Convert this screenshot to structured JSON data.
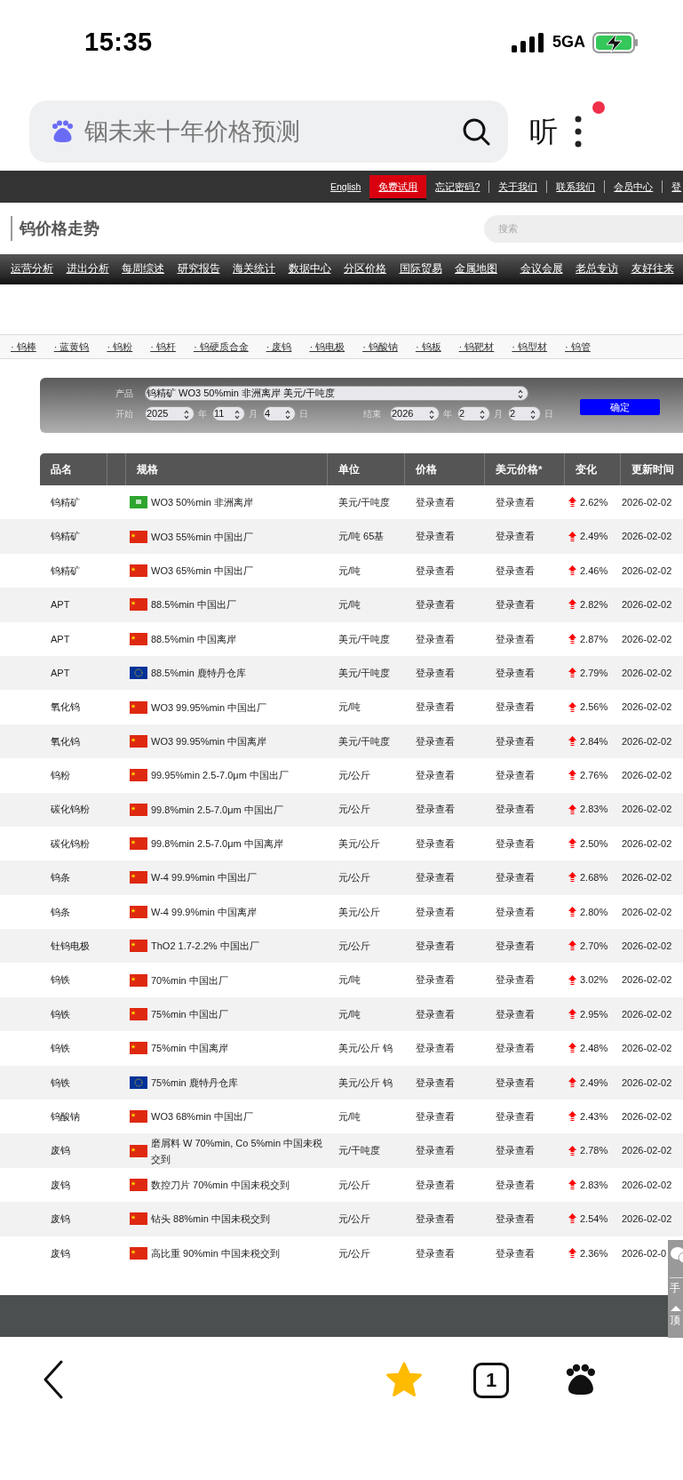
{
  "status_bar": {
    "time": "15:35",
    "network": "5GA"
  },
  "browser": {
    "query": "铟未来十年价格预测",
    "listen": "听",
    "menu_badge": true
  },
  "top_links": [
    {
      "label": "English",
      "kind": "plain"
    },
    {
      "label": "免费试用",
      "kind": "highlight"
    },
    {
      "label": "忘记密码?",
      "kind": "plain"
    },
    {
      "label": "关于我们",
      "kind": "divided"
    },
    {
      "label": "联系我们",
      "kind": "divided"
    },
    {
      "label": "会员中心",
      "kind": "divided"
    },
    {
      "label": "登",
      "kind": "divided"
    }
  ],
  "site": {
    "title": "钨价格走势",
    "search_placeholder": "搜索"
  },
  "nav_left": [
    "运营分析",
    "进出分析",
    "每周综述",
    "研究报告",
    "海关统计",
    "数据中心",
    "分区价格",
    "国际贸易",
    "金属地图"
  ],
  "nav_right": [
    "会议会展",
    "老总专访",
    "友好往来"
  ],
  "categories": [
    "· 钨棒",
    "· 蓝黄钨",
    "· 钨粉",
    "· 钨杆",
    "· 钨硬质合金",
    "· 废钨",
    "· 钨电极",
    "· 钨酸钠",
    "· 钨板",
    "· 钨靶材",
    "· 钨型材",
    "· 钨管"
  ],
  "filter": {
    "product_label": "产品",
    "product": "钨精矿 WO3 50%min 非洲离岸 美元/干吨度",
    "start_label": "开始",
    "start_year": "2025",
    "start_month": "11",
    "start_day": "4",
    "end_label": "结束",
    "end_year": "2026",
    "end_month": "2",
    "end_day": "2",
    "year_unit": "年",
    "month_unit": "月",
    "day_unit": "日",
    "end_year_unit": "年",
    "end_month_unit": "月",
    "end_day_unit": "日",
    "submit": "确定"
  },
  "table": {
    "columns": [
      "品名",
      "规格",
      "单位",
      "价格",
      "美元价格*",
      "变化",
      "更新时间"
    ],
    "rows": [
      {
        "product": "钨精矿",
        "flag": {
          "kind": "green"
        },
        "spec": "WO3 50%min 非洲离岸",
        "unit": "美元/干吨度",
        "price": "登录查看",
        "usd_price": "登录查看",
        "change": "2.62%",
        "updated": "2026-02-02"
      },
      {
        "product": "钨精矿",
        "flag": {
          "kind": "cn"
        },
        "spec": "WO3 55%min 中国出厂",
        "unit": "元/吨 65基",
        "price": "登录查看",
        "usd_price": "登录查看",
        "change": "2.49%",
        "updated": "2026-02-02"
      },
      {
        "product": "钨精矿",
        "flag": {
          "kind": "cn"
        },
        "spec": "WO3 65%min 中国出厂",
        "unit": "元/吨",
        "price": "登录查看",
        "usd_price": "登录查看",
        "change": "2.46%",
        "updated": "2026-02-02"
      },
      {
        "product": "APT",
        "flag": {
          "kind": "cn"
        },
        "spec": "88.5%min 中国出厂",
        "unit": "元/吨",
        "price": "登录查看",
        "usd_price": "登录查看",
        "change": "2.82%",
        "updated": "2026-02-02"
      },
      {
        "product": "APT",
        "flag": {
          "kind": "cn"
        },
        "spec": "88.5%min 中国离岸",
        "unit": "美元/干吨度",
        "price": "登录查看",
        "usd_price": "登录查看",
        "change": "2.87%",
        "updated": "2026-02-02"
      },
      {
        "product": "APT",
        "flag": {
          "kind": "eu"
        },
        "spec": "88.5%min 鹿特丹仓库",
        "unit": "美元/干吨度",
        "price": "登录查看",
        "usd_price": "登录查看",
        "change": "2.79%",
        "updated": "2026-02-02"
      },
      {
        "product": "氧化钨",
        "flag": {
          "kind": "cn"
        },
        "spec": "WO3 99.95%min 中国出厂",
        "unit": "元/吨",
        "price": "登录查看",
        "usd_price": "登录查看",
        "change": "2.56%",
        "updated": "2026-02-02"
      },
      {
        "product": "氧化钨",
        "flag": {
          "kind": "cn"
        },
        "spec": "WO3 99.95%min 中国离岸",
        "unit": "美元/干吨度",
        "price": "登录查看",
        "usd_price": "登录查看",
        "change": "2.84%",
        "updated": "2026-02-02"
      },
      {
        "product": "钨粉",
        "flag": {
          "kind": "cn"
        },
        "spec": "99.95%min 2.5-7.0μm 中国出厂",
        "unit": "元/公斤",
        "price": "登录查看",
        "usd_price": "登录查看",
        "change": "2.76%",
        "updated": "2026-02-02"
      },
      {
        "product": "碳化钨粉",
        "flag": {
          "kind": "cn"
        },
        "spec": "99.8%min 2.5-7.0μm 中国出厂",
        "unit": "元/公斤",
        "price": "登录查看",
        "usd_price": "登录查看",
        "change": "2.83%",
        "updated": "2026-02-02"
      },
      {
        "product": "碳化钨粉",
        "flag": {
          "kind": "cn"
        },
        "spec": "99.8%min 2.5-7.0μm 中国离岸",
        "unit": "美元/公斤",
        "price": "登录查看",
        "usd_price": "登录查看",
        "change": "2.50%",
        "updated": "2026-02-02"
      },
      {
        "product": "钨条",
        "flag": {
          "kind": "cn"
        },
        "spec": "W-4 99.9%min 中国出厂",
        "unit": "元/公斤",
        "price": "登录查看",
        "usd_price": "登录查看",
        "change": "2.68%",
        "updated": "2026-02-02"
      },
      {
        "product": "钨条",
        "flag": {
          "kind": "cn"
        },
        "spec": "W-4 99.9%min 中国离岸",
        "unit": "美元/公斤",
        "price": "登录查看",
        "usd_price": "登录查看",
        "change": "2.80%",
        "updated": "2026-02-02"
      },
      {
        "product": "钍钨电极",
        "flag": {
          "kind": "cn"
        },
        "spec": "ThO2 1.7-2.2% 中国出厂",
        "unit": "元/公斤",
        "price": "登录查看",
        "usd_price": "登录查看",
        "change": "2.70%",
        "updated": "2026-02-02"
      },
      {
        "product": "钨铁",
        "flag": {
          "kind": "cn"
        },
        "spec": "70%min 中国出厂",
        "unit": "元/吨",
        "price": "登录查看",
        "usd_price": "登录查看",
        "change": "3.02%",
        "updated": "2026-02-02"
      },
      {
        "product": "钨铁",
        "flag": {
          "kind": "cn"
        },
        "spec": "75%min 中国出厂",
        "unit": "元/吨",
        "price": "登录查看",
        "usd_price": "登录查看",
        "change": "2.95%",
        "updated": "2026-02-02"
      },
      {
        "product": "钨铁",
        "flag": {
          "kind": "cn"
        },
        "spec": "75%min 中国离岸",
        "unit": "美元/公斤 钨",
        "price": "登录查看",
        "usd_price": "登录查看",
        "change": "2.48%",
        "updated": "2026-02-02"
      },
      {
        "product": "钨铁",
        "flag": {
          "kind": "eu"
        },
        "spec": "75%min 鹿特丹仓库",
        "unit": "美元/公斤 钨",
        "price": "登录查看",
        "usd_price": "登录查看",
        "change": "2.49%",
        "updated": "2026-02-02"
      },
      {
        "product": "钨酸钠",
        "flag": {
          "kind": "cn"
        },
        "spec": "WO3 68%min 中国出厂",
        "unit": "元/吨",
        "price": "登录查看",
        "usd_price": "登录查看",
        "change": "2.43%",
        "updated": "2026-02-02"
      },
      {
        "product": "废钨",
        "flag": {
          "kind": "cn"
        },
        "spec": "磨屑料 W 70%min, Co 5%min 中国未税交到",
        "unit": "元/干吨度",
        "price": "登录查看",
        "usd_price": "登录查看",
        "change": "2.78%",
        "updated": "2026-02-02"
      },
      {
        "product": "废钨",
        "flag": {
          "kind": "cn"
        },
        "spec": "数控刀片 70%min 中国未税交到",
        "unit": "元/公斤",
        "price": "登录查看",
        "usd_price": "登录查看",
        "change": "2.83%",
        "updated": "2026-02-02"
      },
      {
        "product": "废钨",
        "flag": {
          "kind": "cn"
        },
        "spec": "钻头 88%min 中国未税交到",
        "unit": "元/公斤",
        "price": "登录查看",
        "usd_price": "登录查看",
        "change": "2.54%",
        "updated": "2026-02-02"
      },
      {
        "product": "废钨",
        "flag": {
          "kind": "cn"
        },
        "spec": "高比重 90%min 中国未税交到",
        "unit": "元/公斤",
        "price": "登录查看",
        "usd_price": "登录查看",
        "change": "2.36%",
        "updated": "2026-02-0"
      }
    ]
  },
  "side_panel": {
    "phone": "手",
    "top": "顶"
  },
  "bottom_bar": {
    "favorited": true,
    "tab_count": "1"
  }
}
